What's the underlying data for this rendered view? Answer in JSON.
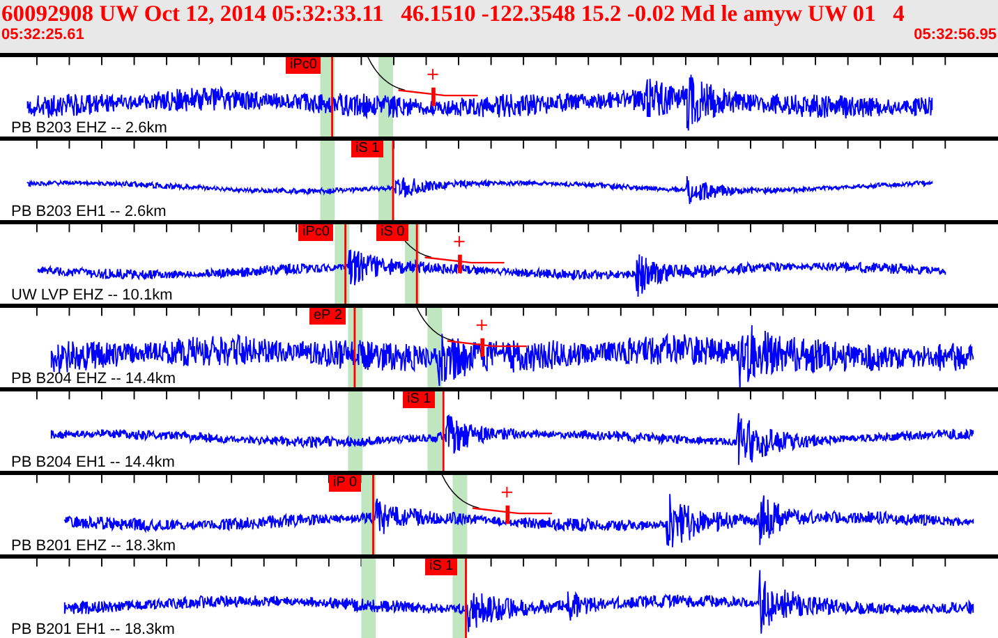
{
  "header": {
    "event_line": "60092908 UW Oct 12, 2014 05:32:33.11   46.1510 -122.3548 15.2 -0.02 Md le amyw UW 01   4",
    "start_time": "05:32:25.61",
    "end_time": "05:32:56.95"
  },
  "traces": [
    {
      "station": "PB B203 EHZ -- 2.6km",
      "picks": [
        "iPc0"
      ]
    },
    {
      "station": "PB B203 EH1 -- 2.6km",
      "picks": [
        "iS 1"
      ]
    },
    {
      "station": "UW LVP EHZ -- 10.1km",
      "picks": [
        "iPc0",
        "iS 0"
      ]
    },
    {
      "station": "PB B204 EHZ -- 14.4km",
      "picks": [
        "eP 2"
      ]
    },
    {
      "station": "PB B204 EH1 -- 14.4km",
      "picks": [
        "iS 1"
      ]
    },
    {
      "station": "PB B201 EHZ -- 18.3km",
      "picks": [
        "iP 0"
      ]
    },
    {
      "station": "PB B201 EH1 -- 18.3km",
      "picks": [
        "iS 1"
      ]
    }
  ]
}
